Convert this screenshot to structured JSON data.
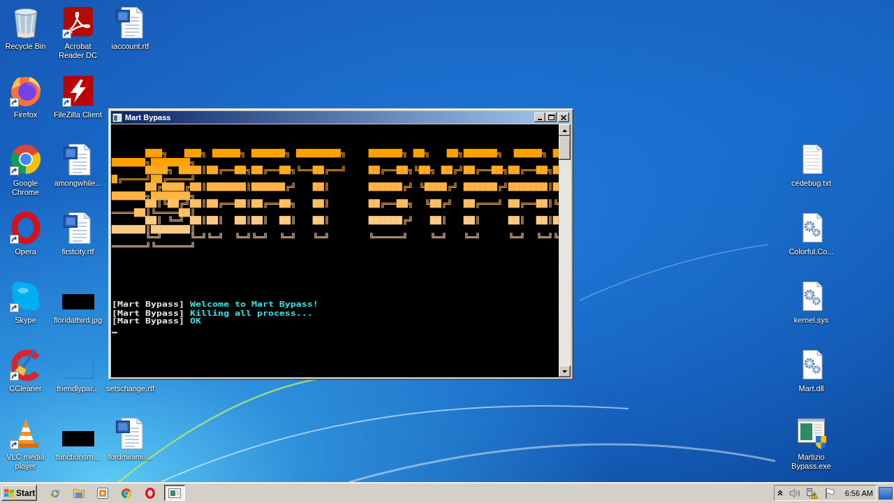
{
  "desktop": {
    "icon_columns": [
      [
        {
          "label": "Recycle Bin",
          "kind": "recycle-bin",
          "shortcut": false
        },
        {
          "label": "Firefox",
          "kind": "firefox",
          "shortcut": true
        },
        {
          "label": "Google Chrome",
          "kind": "chrome",
          "shortcut": true
        },
        {
          "label": "Opera",
          "kind": "opera",
          "shortcut": true
        },
        {
          "label": "Skype",
          "kind": "skype",
          "shortcut": true
        },
        {
          "label": "CCleaner",
          "kind": "ccleaner",
          "shortcut": true
        },
        {
          "label": "VLC media player",
          "kind": "vlc",
          "shortcut": true
        }
      ],
      [
        {
          "label": "Acrobat Reader DC",
          "kind": "acrobat",
          "shortcut": true
        },
        {
          "label": "FileZilla Client",
          "kind": "filezilla",
          "shortcut": true
        },
        {
          "label": "amongwhile...",
          "kind": "word-doc",
          "shortcut": false
        },
        {
          "label": "firstcity.rtf",
          "kind": "word-doc",
          "shortcut": false
        },
        {
          "label": "floridathird.jpg",
          "kind": "black-thumbnail",
          "shortcut": false
        },
        {
          "label": "friendlypar...",
          "kind": "blank",
          "shortcut": false
        },
        {
          "label": "functionsm...",
          "kind": "black-thumbnail",
          "shortcut": false
        }
      ],
      [
        {
          "label": "iaccount.rtf",
          "kind": "word-doc",
          "shortcut": false
        },
        {
          "label": "setschange.rtf"
        },
        {
          "label": "fordminimu...",
          "kind": "word-doc",
          "shortcut": false
        }
      ]
    ],
    "right_column": [
      {
        "label": "cedebug.txt",
        "kind": "text-file",
        "shortcut": false
      },
      {
        "label": "Colorful.Co...",
        "kind": "gear-file",
        "shortcut": false
      },
      {
        "label": "kernel.sys",
        "kind": "gear-file",
        "shortcut": false
      },
      {
        "label": "Mart.dll",
        "kind": "gear-file",
        "shortcut": false
      },
      {
        "label": "Martizio Bypass.exe",
        "kind": "program",
        "shortcut": false
      }
    ]
  },
  "window": {
    "title": "Mart Bypass",
    "banner": [
      {
        "text": "      ███╗   ███╗ █████╗ ██████╗ ████████╗    ██████╗ ██╗   ██╗██████╗  █████╗ ███████╗███████╗",
        "color": "#ffa200"
      },
      {
        "text": "      ████╗ ████║██╔══██╗██╔══██╗╚══██╔══╝    ██╔══██╗╚██╗ ██╔╝██╔══██╗██╔══██╗██╔════╝██╔════╝",
        "color": "#ffaa22"
      },
      {
        "text": "      ██╔████╔██║███████║██████╔╝   ██║       ██████╔╝ ╚████╔╝ ██████╔╝███████║███████╗███████╗",
        "color": "#ffb444"
      },
      {
        "text": "      ██║╚██╔╝██║██╔══██║██╔══██╗   ██║       ██╔══██╗  ╚██╔╝  ██╔═══╝ ██╔══██║╚════██║╚════██║",
        "color": "#ffbf62"
      },
      {
        "text": "      ██║ ╚═╝ ██║██║  ██║██║  ██║   ██║       ██████╔╝   ██║   ██║     ██║  ██║███████║███████║",
        "color": "#ffcb84"
      },
      {
        "text": "      ╚═╝     ╚═╝╚═╝  ╚═╝╚═╝  ╚═╝   ╚═╝       ╚═════╝    ╚═╝   ╚═╝     ╚═╝  ╚═╝╚══════╝╚══════╝",
        "color": "#ffd8a6"
      }
    ],
    "log": [
      {
        "prefix": "[Mart Bypass]",
        "message": "Welcome to Mart Bypass!"
      },
      {
        "prefix": "[Mart Bypass]",
        "message": "Killing all process..."
      },
      {
        "prefix": "[Mart Bypass]",
        "message": "OK"
      }
    ]
  },
  "taskbar": {
    "start_label": "Start",
    "window_button": {
      "active": true
    },
    "clock": "6:56 AM"
  }
}
